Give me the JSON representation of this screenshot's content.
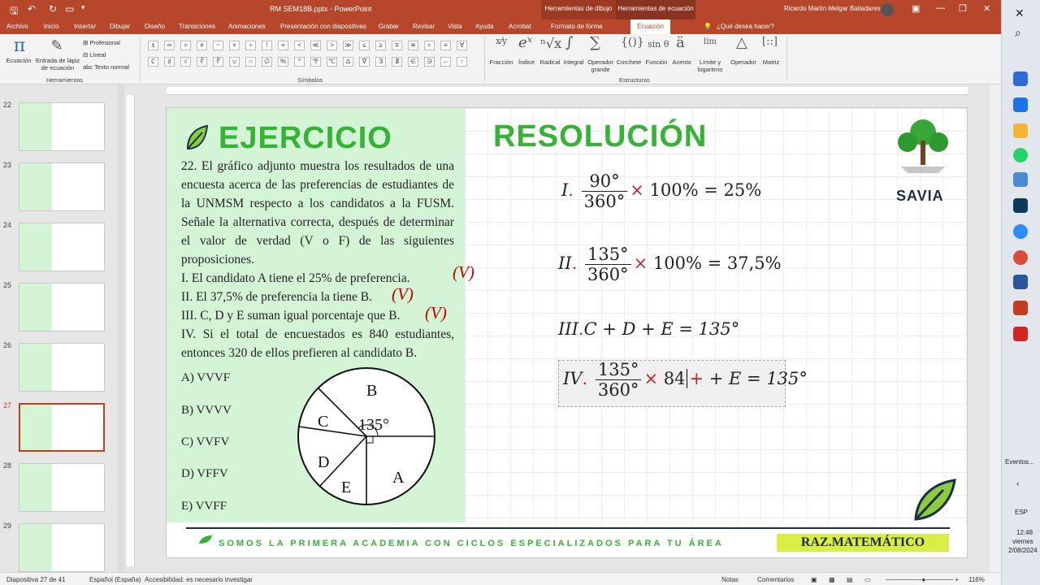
{
  "titlebar": {
    "doc_title": "RM SEM18B.pptx  -  PowerPoint",
    "ctx_drawing": "Herramientas de dibujo",
    "ctx_equation": "Herramientas de ecuación",
    "user": "Ricardo Martin Melgar Balladares"
  },
  "tabs": [
    "Archivo",
    "Inicio",
    "Insertar",
    "Dibujar",
    "Diseño",
    "Transiciones",
    "Animaciones",
    "Presentación con diapositivas",
    "Grabar",
    "Revisar",
    "Vista",
    "Ayuda",
    "Acrobat",
    "Formato de forma",
    "Ecuación"
  ],
  "tell_me": "¿Qué desea hacer?",
  "ribbon": {
    "equation": "Ecuación",
    "ink": "Entrada de lápiz de ecuación",
    "professional": "Profesional",
    "linear": "Lineal",
    "normal_text": "Texto normal",
    "group_tools": "Herramientas",
    "group_symbols": "Símbolos",
    "group_structures": "Estructuras",
    "symbols_row1": [
      "±",
      "∞",
      "=",
      "≠",
      "~",
      "×",
      "÷",
      "!",
      "∝",
      "<",
      "≪",
      ">",
      "≫",
      "≤",
      "≥",
      "∓",
      "≅",
      "≈",
      "≡",
      "∀"
    ],
    "symbols_row2": [
      "∁",
      "∂",
      "√",
      "∛",
      "∜",
      "∪",
      "∩",
      "∅",
      "%",
      "°",
      "℉",
      "℃",
      "∆",
      "∇",
      "∃",
      "∄",
      "∈",
      "∋",
      "←",
      "↑"
    ],
    "structures": [
      "Fracción",
      "Índice",
      "Radical",
      "Integral",
      "Operador grande",
      "Corchete",
      "Función",
      "Acento",
      "Límite y logaritmo",
      "Operador",
      "Matriz"
    ]
  },
  "thumbnails": [
    {
      "n": "22"
    },
    {
      "n": "23"
    },
    {
      "n": "24"
    },
    {
      "n": "25"
    },
    {
      "n": "26"
    },
    {
      "n": "27"
    },
    {
      "n": "28"
    },
    {
      "n": "29"
    }
  ],
  "slide": {
    "title_left": "EJERCICIO",
    "title_right": "RESOLUCIÓN",
    "brand": "SAVIA",
    "problem": "22. El gráfico adjunto muestra los resultados de una encuesta acerca de las preferencias de estudiantes de la UNMSM respecto a los candidatos a la FUSM. Señale la alternativa correcta, después de determinar el valor de verdad (V o F) de las siguientes proposiciones.",
    "props": [
      "I. El candidato A tiene el 25% de preferencia.",
      "II. El 37,5% de preferencia la tiene B.",
      "III. C, D y E suman igual porcentaje que B.",
      "IV. Si el total de encuestados es 840 estudiantes, entonces 320 de ellos prefieren al candidato B."
    ],
    "marks": [
      "(V)",
      "(V)",
      "(V)"
    ],
    "options": [
      "A) VVVF",
      "B) VVVV",
      "C) VVFV",
      "D) VFFV",
      "E) VVFF"
    ],
    "pie": {
      "labels": [
        "B",
        "C",
        "D",
        "E",
        "A"
      ],
      "angle_label": "135°"
    },
    "eq1": {
      "pre": "I",
      "num": "90°",
      "den": "360°",
      "rest": "100% = 25%"
    },
    "eq2": {
      "pre": "II",
      "num": "135°",
      "den": "360°",
      "rest": "100% = 37,5%"
    },
    "eq3": {
      "pre": "III",
      "body": "C + D + E = 135°"
    },
    "eq4": {
      "pre": "IV",
      "num": "135°",
      "den": "360°",
      "mid": "84",
      "rest": "+ E = 135°"
    },
    "footer": "SOMOS LA PRIMERA ACADEMIA CON CICLOS ESPECIALIZADOS PARA TU ÁREA",
    "subject": "RAZ.MATEMÁTICO"
  },
  "status": {
    "slide": "Diapositiva 27 de 41",
    "lang": "Español (España)",
    "access": "Accesibilidad: es necesario investigar",
    "notes": "Notas",
    "comments": "Comentarios",
    "zoom": "116%"
  },
  "taskbar": {
    "events": "Eventos...",
    "lang": "ESP",
    "time": "12:48",
    "day": "viernes",
    "date": "2/08/2024"
  }
}
